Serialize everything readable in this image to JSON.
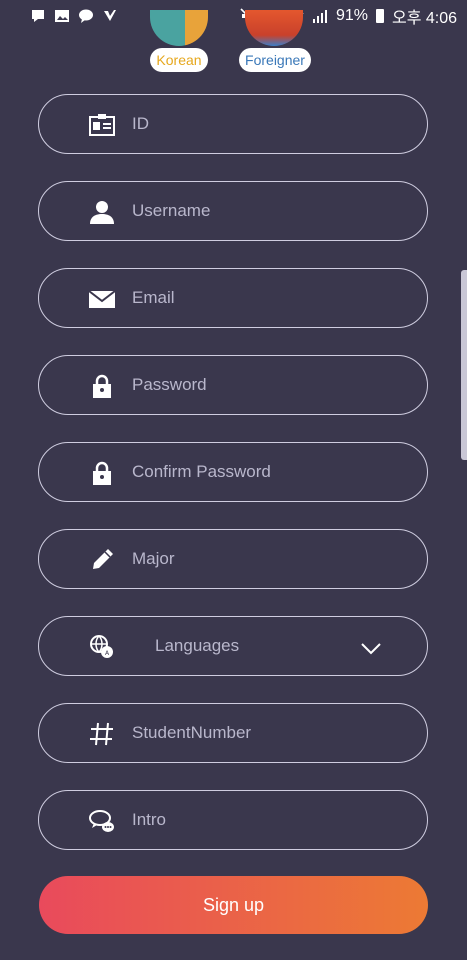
{
  "status_bar": {
    "battery": "91%",
    "time": "오후 4:06",
    "icons": [
      "talk-icon",
      "image-icon",
      "chat-icon",
      "check-icon",
      "mute-icon",
      "alarm-icon",
      "wifi-icon",
      "signal-icon",
      "battery-icon"
    ]
  },
  "user_types": [
    {
      "label": "Korean"
    },
    {
      "label": "Foreigner"
    }
  ],
  "fields": {
    "id": "ID",
    "username": "Username",
    "email": "Email",
    "password": "Password",
    "confirm_password": "Confirm Password",
    "major": "Major",
    "languages": "Languages",
    "student_number": "StudentNumber",
    "intro": "Intro"
  },
  "signup_label": "Sign up",
  "colors": {
    "background": "#3a374d",
    "border": "#cfcde0",
    "button_start": "#e94a5c",
    "button_end": "#ec7a34"
  }
}
